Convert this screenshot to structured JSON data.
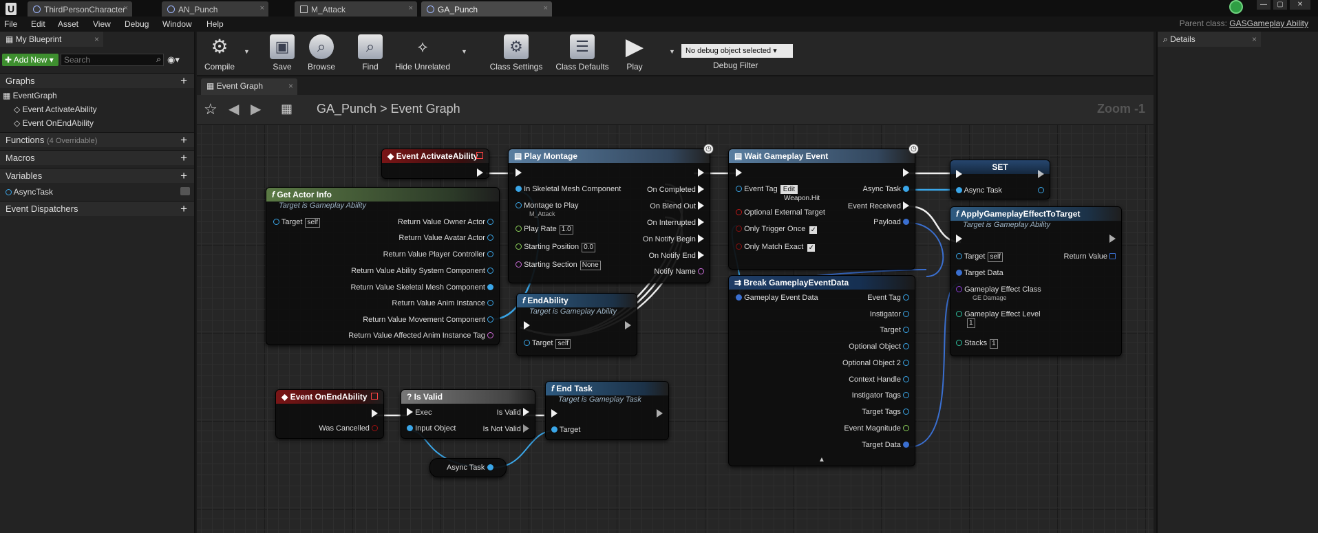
{
  "tabs": [
    {
      "label": "ThirdPersonCharacter"
    },
    {
      "label": "AN_Punch"
    },
    {
      "label": "M_Attack"
    },
    {
      "label": "GA_Punch"
    }
  ],
  "menu": [
    "File",
    "Edit",
    "Asset",
    "View",
    "Debug",
    "Window",
    "Help"
  ],
  "parent_class": {
    "label": "Parent class:",
    "value": "GASGameplay Ability"
  },
  "left": {
    "tab": "My Blueprint",
    "add_new": "Add New",
    "search_placeholder": "Search",
    "graphs": "Graphs",
    "eventgraph": "EventGraph",
    "event1": "Event ActivateAbility",
    "event2": "Event OnEndAbility",
    "functions": "Functions",
    "functions_count": "(4 Overridable)",
    "macros": "Macros",
    "variables": "Variables",
    "var1": "AsyncTask",
    "dispatchers": "Event Dispatchers"
  },
  "toolbar": {
    "compile": "Compile",
    "save": "Save",
    "browse": "Browse",
    "find": "Find",
    "hide_unrelated": "Hide Unrelated",
    "class_settings": "Class Settings",
    "class_defaults": "Class Defaults",
    "play": "Play",
    "debug_select": "No debug object selected",
    "debug_filter": "Debug Filter"
  },
  "graph_tab": "Event Graph",
  "breadcrumb": {
    "root": "GA_Punch",
    "sep": ">",
    "current": "Event Graph"
  },
  "zoom": "Zoom -1",
  "details_tab": "Details",
  "nodes": {
    "activate": {
      "title": "Event ActivateAbility"
    },
    "actorinfo": {
      "title": "Get Actor Info",
      "sub": "Target is Gameplay Ability",
      "target": "Target",
      "self": "self",
      "outputs": [
        "Return Value Owner Actor",
        "Return Value Avatar Actor",
        "Return Value Player Controller",
        "Return Value Ability System Component",
        "Return Value Skeletal Mesh Component",
        "Return Value Anim Instance",
        "Return Value Movement Component",
        "Return Value Affected Anim Instance Tag"
      ]
    },
    "montage": {
      "title": "Play Montage",
      "in_mesh": "In Skeletal Mesh Component",
      "montage": "Montage to Play",
      "montage_val": "M_Attack",
      "rate": "Play Rate",
      "rate_val": "1.0",
      "start": "Starting Position",
      "start_val": "0.0",
      "section": "Starting Section",
      "section_val": "None",
      "outputs": [
        "On Completed",
        "On Blend Out",
        "On Interrupted",
        "On Notify Begin",
        "On Notify End",
        "Notify Name"
      ]
    },
    "wait": {
      "title": "Wait Gameplay Event",
      "tag": "Event Tag",
      "edit": "Edit",
      "tag_val": "Weapon.Hit",
      "ext": "Optional External Target",
      "trigger": "Only Trigger Once",
      "match": "Only Match Exact",
      "async": "Async Task",
      "received": "Event Received",
      "payload": "Payload"
    },
    "set": {
      "title": "SET",
      "pin": "Async Task"
    },
    "apply": {
      "title": "ApplyGameplayEffectToTarget",
      "sub": "Target is Gameplay Ability",
      "target": "Target",
      "self": "self",
      "ret": "Return Value",
      "tdata": "Target Data",
      "gec": "Gameplay Effect Class",
      "gec_val": "GE Damage",
      "level": "Gameplay Effect Level",
      "level_val": "1",
      "stacks": "Stacks",
      "stacks_val": "1"
    },
    "endability": {
      "title": "EndAbility",
      "sub": "Target is Gameplay Ability",
      "target": "Target",
      "self": "self"
    },
    "break": {
      "title": "Break GameplayEventData",
      "input": "Gameplay Event Data",
      "outputs": [
        "Event Tag",
        "Instigator",
        "Target",
        "Optional Object",
        "Optional Object 2",
        "Context Handle",
        "Instigator Tags",
        "Target Tags",
        "Event Magnitude",
        "Target Data"
      ]
    },
    "onend": {
      "title": "Event OnEndAbility",
      "cancel": "Was Cancelled"
    },
    "isvalid": {
      "title": "Is Valid",
      "exec": "Exec",
      "valid": "Is Valid",
      "input": "Input Object",
      "notvalid": "Is Not Valid"
    },
    "endtask": {
      "title": "End Task",
      "sub": "Target is Gameplay Task",
      "target": "Target"
    },
    "asyncvar": {
      "title": "Async Task"
    }
  }
}
